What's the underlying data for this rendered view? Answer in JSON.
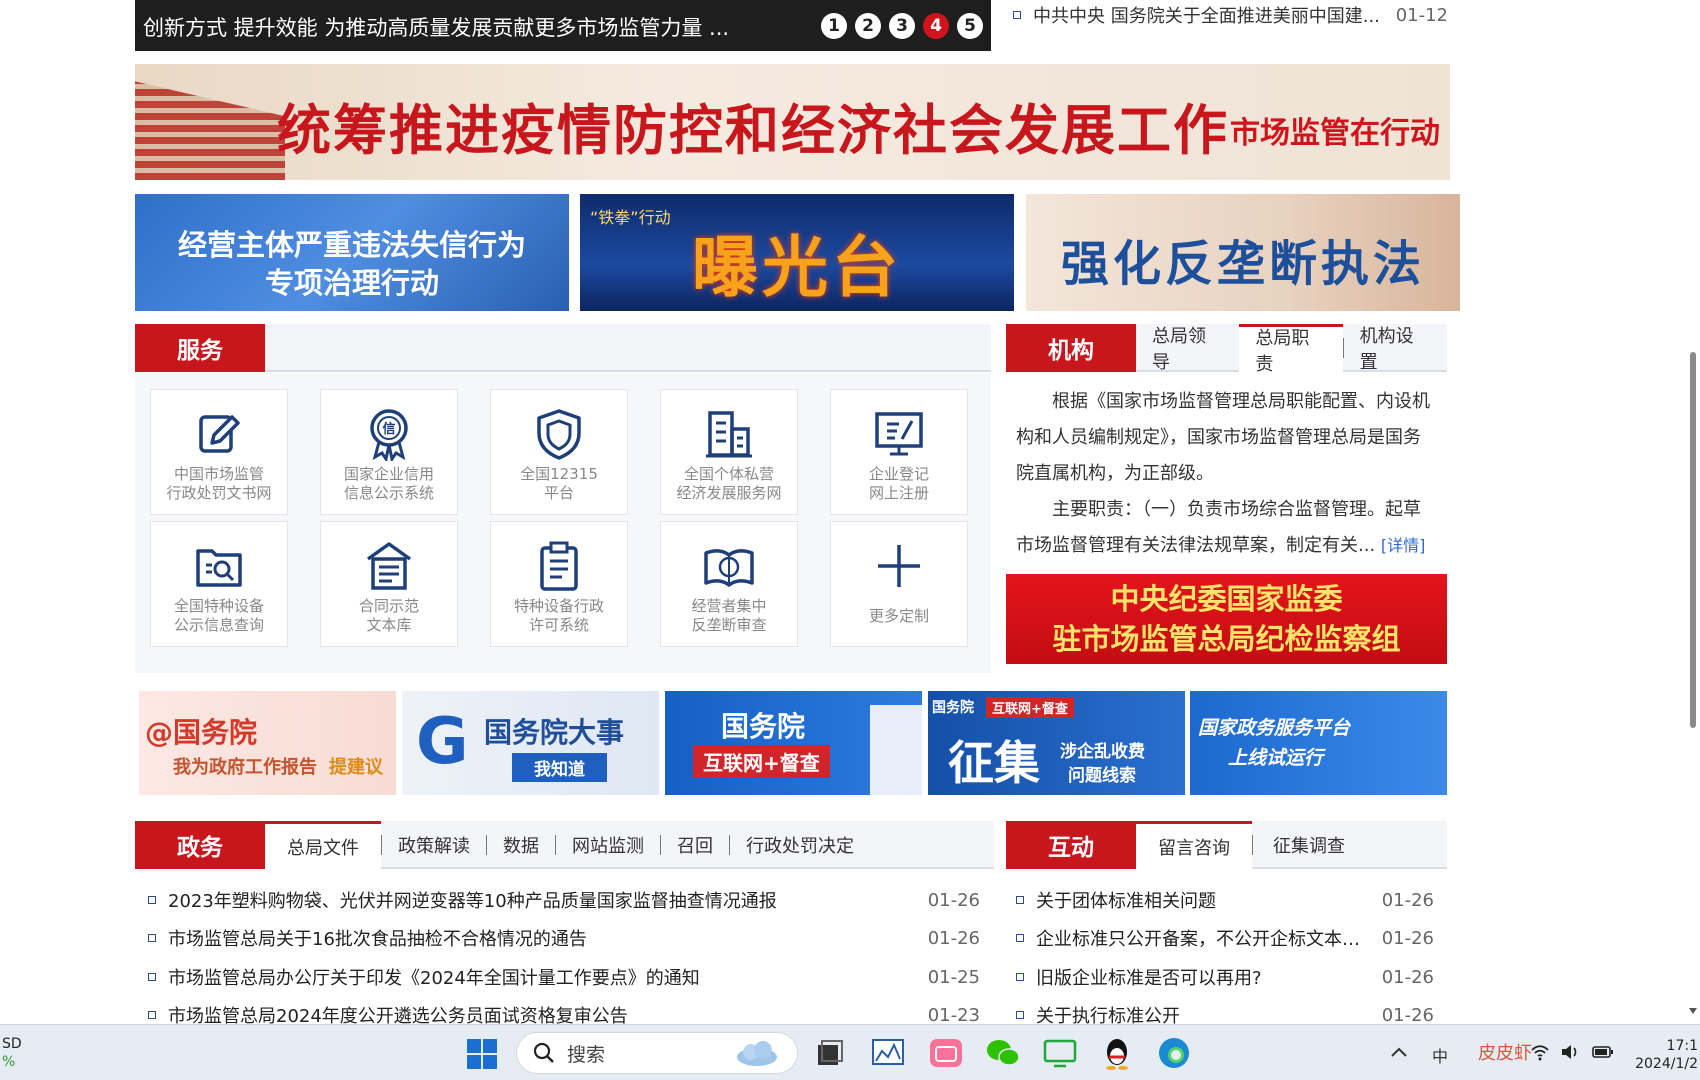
{
  "slider": {
    "caption": "创新方式 提升效能 为推动高质量发展贡献更多市场监管力量 ...",
    "dots": [
      "1",
      "2",
      "3",
      "4",
      "5"
    ],
    "active_dot": 3
  },
  "top_news": {
    "title": "中共中央 国务院关于全面推进美丽中国建...",
    "date": "01-12"
  },
  "big_banner": {
    "main": "统筹推进疫情防控和经济社会发展工作",
    "side": "市场监管在行动"
  },
  "promos": {
    "p1_line1": "经营主体严重违法失信行为",
    "p1_line2": "专项治理行动",
    "p2_small": "“铁拳”行动",
    "p2_big": "曝光台",
    "p3_big": "强化反垄断执法"
  },
  "service": {
    "tag": "服务",
    "items": [
      {
        "label": "中国市场监管\n行政处罚文书网",
        "icon": "pen-document-icon"
      },
      {
        "label": "国家企业信用\n信息公示系统",
        "icon": "credit-medal-icon"
      },
      {
        "label": "全国12315\n平台",
        "icon": "shield-icon"
      },
      {
        "label": "全国个体私营\n经济发展服务网",
        "icon": "building-icon"
      },
      {
        "label": "企业登记\n网上注册",
        "icon": "monitor-icon"
      },
      {
        "label": "全国特种设备\n公示信息查询",
        "icon": "folder-search-icon"
      },
      {
        "label": "合同示范\n文本库",
        "icon": "contract-icon"
      },
      {
        "label": "特种设备行政\n许可系统",
        "icon": "clipboard-icon"
      },
      {
        "label": "经营者集中\n反垄断审查",
        "icon": "book-review-icon"
      },
      {
        "label": "更多定制",
        "icon": "plus-icon"
      }
    ]
  },
  "org": {
    "tag": "机构",
    "tabs": [
      "总局领导",
      "总局职责",
      "机构设置"
    ],
    "active_tab": 1,
    "para1": "根据《国家市场监督管理总局职能配置、内设机构和人员编制规定》，国家市场监督管理总局是国务院直属机构，为正部级。",
    "para2": "主要职责：（一）负责市场综合监督管理。起草市场监督管理有关法律法规草案，制定有关...",
    "more": "[详情]",
    "red_banner_l1": "中央纪委国家监委",
    "red_banner_l2": "驻市场监管总局纪检监察组"
  },
  "small_banners": {
    "b1_l1": "@国务院",
    "b1_l2": "我为政府工作报告",
    "b1_l3": "提建议",
    "b2_l1": "国务院大事",
    "b2_l2": "我知道",
    "b3_l1": "国务院",
    "b3_l2": "互联网+督查",
    "b4_tag1": "国务院",
    "b4_tag2": "互联网+督查",
    "b4_big": "征集",
    "b4_s1": "涉企乱收费",
    "b4_s2": "问题线索",
    "b5_l1": "国家政务服务平台",
    "b5_l2": "上线试运行"
  },
  "gov": {
    "tag": "政务",
    "tabs": [
      "总局文件",
      "政策解读",
      "数据",
      "网站监测",
      "召回",
      "行政处罚决定"
    ],
    "active_tab": 0,
    "items": [
      {
        "title": "2023年塑料购物袋、光伏并网逆变器等10种产品质量国家监督抽查情况通报",
        "date": "01-26"
      },
      {
        "title": "市场监管总局关于16批次食品抽检不合格情况的通告",
        "date": "01-26"
      },
      {
        "title": "市场监管总局办公厅关于印发《2024年全国计量工作要点》的通知",
        "date": "01-25"
      },
      {
        "title": "市场监管总局2024年度公开遴选公务员面试资格复审公告",
        "date": "01-23"
      }
    ]
  },
  "interact": {
    "tag": "互动",
    "tabs": [
      "留言咨询",
      "征集调查"
    ],
    "active_tab": 0,
    "items": [
      {
        "title": "关于团体标准相关问题",
        "date": "01-26"
      },
      {
        "title": "企业标准只公开备案，不公开企标文本…",
        "date": "01-26"
      },
      {
        "title": "旧版企业标准是否可以再用?",
        "date": "01-26"
      },
      {
        "title": "关于执行标准公开",
        "date": "01-26"
      }
    ]
  },
  "taskbar": {
    "left_l1": "SD",
    "left_l2": "%",
    "search_placeholder": "搜索",
    "ime": "中",
    "tray_app": "皮皮虾",
    "time": "17:1",
    "date": "2024/1/2"
  },
  "colors": {
    "accent": "#c8161d",
    "link": "#2d6ad6",
    "taskbar": "#e6ecf3"
  }
}
